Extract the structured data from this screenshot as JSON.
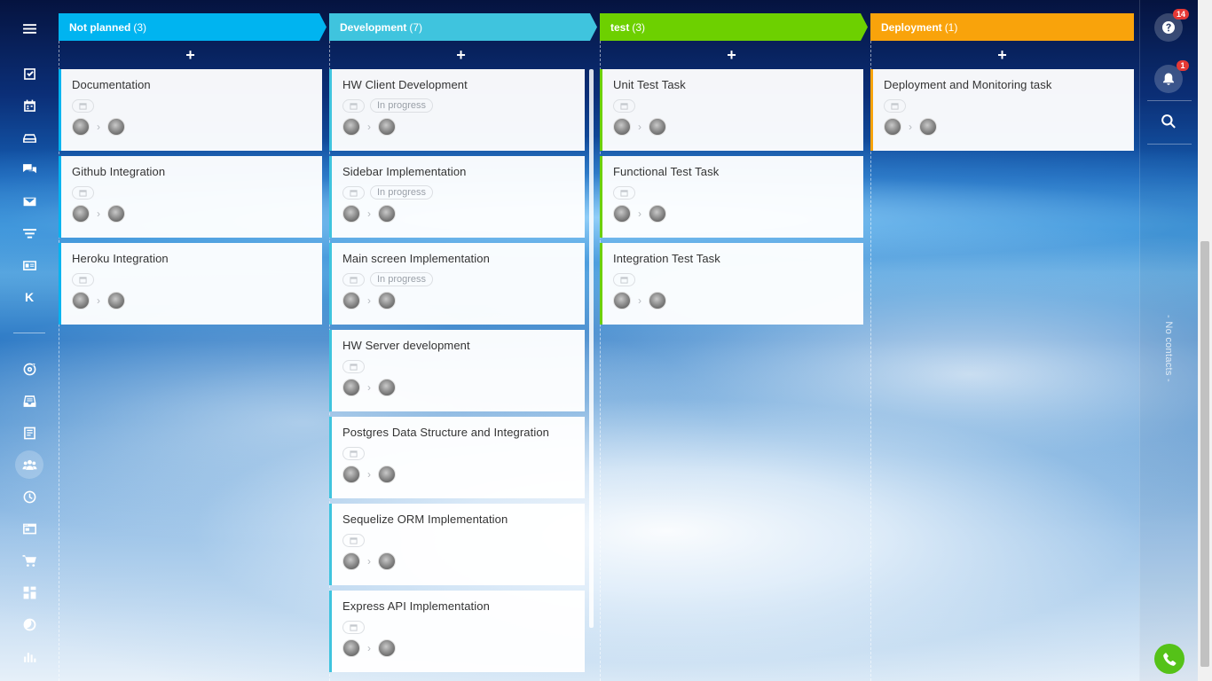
{
  "sidebar_right": {
    "help_badge": "14",
    "notifications_badge": "1",
    "no_contacts_label": "- No contacts -"
  },
  "columns": [
    {
      "name": "Not planned",
      "count": "(3)",
      "color": "#00b4f0",
      "cards": [
        {
          "title": "Documentation",
          "status": ""
        },
        {
          "title": "Github Integration",
          "status": ""
        },
        {
          "title": "Heroku Integration",
          "status": ""
        }
      ]
    },
    {
      "name": "Development",
      "count": "(7)",
      "color": "#3fc4de",
      "cards": [
        {
          "title": "HW Client Development",
          "status": "In progress"
        },
        {
          "title": "Sidebar Implementation",
          "status": "In progress"
        },
        {
          "title": "Main screen Implementation",
          "status": "In progress"
        },
        {
          "title": "HW Server development",
          "status": ""
        },
        {
          "title": "Postgres Data Structure and Integration",
          "status": ""
        },
        {
          "title": "Sequelize ORM Implementation",
          "status": ""
        },
        {
          "title": "Express API Implementation",
          "status": ""
        }
      ]
    },
    {
      "name": "test",
      "count": "(3)",
      "color": "#6dd000",
      "cards": [
        {
          "title": "Unit Test Task",
          "status": ""
        },
        {
          "title": "Functional Test Task",
          "status": ""
        },
        {
          "title": "Integration Test Task",
          "status": ""
        }
      ]
    },
    {
      "name": "Deployment",
      "count": "(1)",
      "color": "#f9a30b",
      "cards": [
        {
          "title": "Deployment and Monitoring task",
          "status": ""
        }
      ]
    }
  ],
  "icons": {
    "menu": "hamburger-menu-icon",
    "add": "plus-icon"
  }
}
